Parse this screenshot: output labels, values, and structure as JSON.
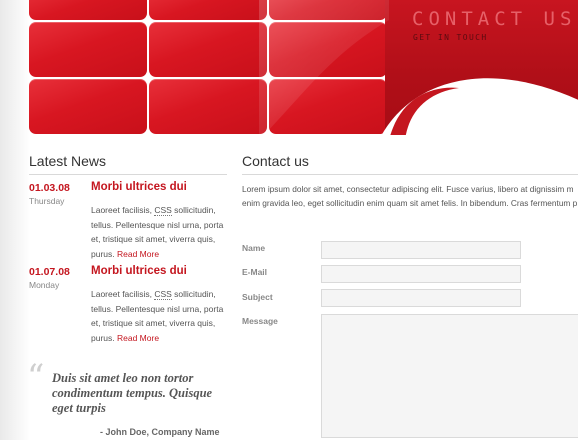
{
  "header": {
    "title": "CONTACT US",
    "subtitle": "GET IN TOUCH",
    "accent_color": "#d81621"
  },
  "news": {
    "heading": "Latest News",
    "items": [
      {
        "date": "01.03.08",
        "day": "Thursday",
        "title": "Morbi ultrices dui",
        "body_before": "Laoreet facilisis, ",
        "abbr": "CSS",
        "body_after": " sollicitudin, tellus. Pellentesque nisl urna, porta et, tristique sit amet, viverra quis, purus. ",
        "link": "Read More"
      },
      {
        "date": "01.07.08",
        "day": "Monday",
        "title": "Morbi ultrices dui",
        "body_before": "Laoreet facilisis, ",
        "abbr": "CSS",
        "body_after": " sollicitudin, tellus. Pellentesque nisl urna, porta et, tristique sit amet, viverra quis, purus. ",
        "link": "Read More"
      }
    ]
  },
  "quote": {
    "text": "Duis sit amet leo non tortor condimentum tempus. Quisque eget turpis",
    "author": "- John Doe, Company Name"
  },
  "contact": {
    "heading": "Contact us",
    "intro_line1": "Lorem ipsum dolor sit amet, consectetur adipiscing elit. Fusce varius, libero at dignissim m",
    "intro_line2": "enim gravida leo, eget sollicitudin enim quam sit amet felis. In bibendum. Cras fermentum p",
    "fields": {
      "name_label": "Name",
      "name_value": "",
      "email_label": "E-Mail",
      "email_value": "",
      "subject_label": "Subject",
      "subject_value": "",
      "message_label": "Message",
      "message_value": ""
    }
  }
}
